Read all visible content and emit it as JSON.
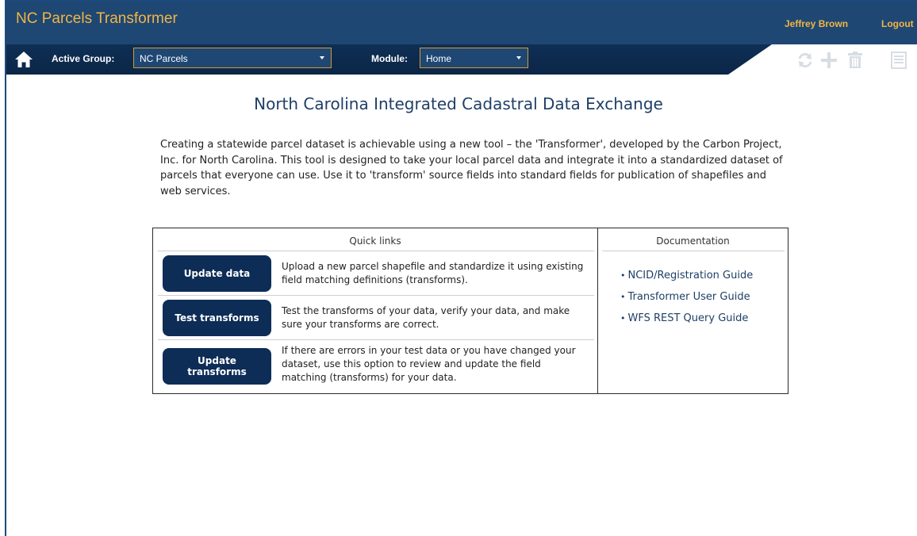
{
  "app": {
    "title": "NC Parcels Transformer",
    "user_name": "Jeffrey Brown",
    "logout_label": "Logout"
  },
  "toolbar": {
    "active_group_label": "Active Group:",
    "active_group_value": "NC Parcels",
    "module_label": "Module:",
    "module_value": "Home",
    "icons": [
      "home-icon",
      "refresh-icon",
      "add-icon",
      "delete-icon",
      "layout-icon"
    ]
  },
  "main": {
    "title": "North Carolina Integrated Cadastral Data Exchange",
    "intro": "Creating a statewide parcel dataset is achievable using a new tool – the 'Transformer', developed by the Carbon Project, Inc. for North Carolina.  This tool is designed to take your local parcel data and integrate it into a standardized dataset of parcels that everyone can use.  Use it to 'transform' source fields into standard fields for publication of shapefiles and web services."
  },
  "quick_links": {
    "header": "Quick links",
    "items": [
      {
        "button": "Update data",
        "description": "Upload a new parcel shapefile and standardize it using existing field matching definitions (transforms)."
      },
      {
        "button": "Test transforms",
        "description": "Test the transforms of your data, verify your data, and make sure your transforms are correct."
      },
      {
        "button": "Update transforms",
        "description": "If there are errors in your test data or you have changed your dataset, use this option to review and update the field matching (transforms) for your data."
      }
    ]
  },
  "documentation": {
    "header": "Documentation",
    "bullet": "•",
    "links": [
      "NCID/Registration Guide",
      "Transformer User Guide",
      "WFS REST Query Guide"
    ]
  },
  "colors": {
    "header_bg": "#1e4774",
    "accent": "#f2b544",
    "button_bg": "#0d2d57",
    "title_text": "#1e3f66"
  }
}
